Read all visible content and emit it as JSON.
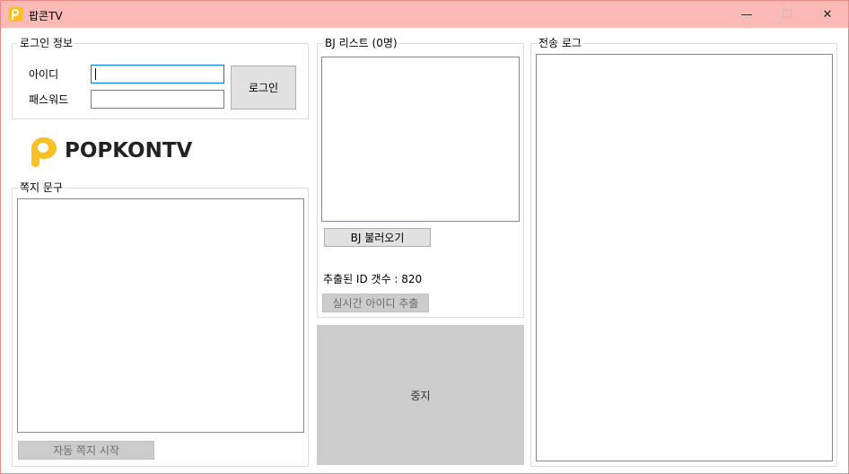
{
  "window": {
    "title": "팝콘TV",
    "minimize_glyph": "—",
    "maximize_glyph": "☐",
    "close_glyph": "✕"
  },
  "login": {
    "group_title": "로그인 정보",
    "id_label": "아이디",
    "id_value": "",
    "password_label": "패스워드",
    "password_value": "",
    "login_button": "로그인"
  },
  "logo": {
    "text": "POPKONTV",
    "icon": "popkon-logo-icon",
    "color": "#fbbf24"
  },
  "message": {
    "group_title": "쪽지 문구",
    "text": "",
    "auto_send_button": "자동 쪽지 시작"
  },
  "bj_list": {
    "group_title": "BJ 리스트 (0명)",
    "items": [],
    "load_button": "BJ 불러오기",
    "extracted_count_text": "추출된 ID 갯수 : 820",
    "realtime_extract_button": "실시간 아이디 추출"
  },
  "stop_button": "중지",
  "send_log": {
    "group_title": "전송 로그",
    "entries": []
  }
}
